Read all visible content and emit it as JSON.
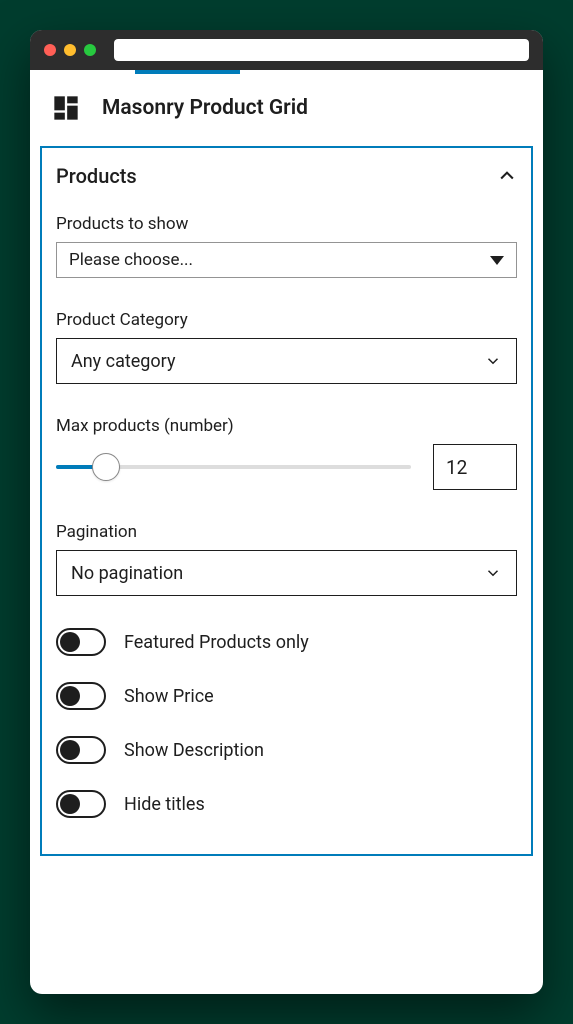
{
  "block": {
    "title": "Masonry Product Grid"
  },
  "panel": {
    "title": "Products"
  },
  "fields": {
    "products_to_show": {
      "label": "Products to show",
      "value": "Please choose..."
    },
    "product_category": {
      "label": "Product Category",
      "value": "Any category"
    },
    "max_products": {
      "label": "Max products (number)",
      "value": "12"
    },
    "pagination": {
      "label": "Pagination",
      "value": "No pagination"
    }
  },
  "toggles": [
    {
      "label": "Featured Products only",
      "checked": false
    },
    {
      "label": "Show Price",
      "checked": false
    },
    {
      "label": "Show Description",
      "checked": false
    },
    {
      "label": "Hide titles",
      "checked": false
    }
  ]
}
